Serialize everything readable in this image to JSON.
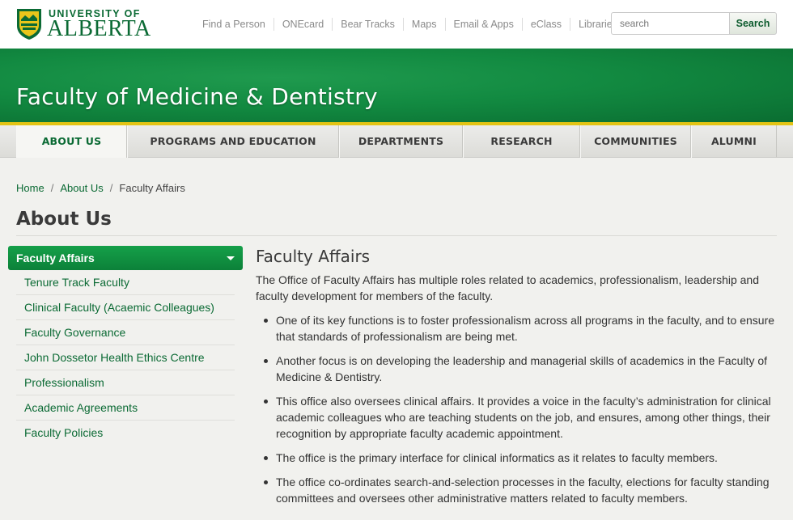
{
  "header": {
    "logo_top": "UNIVERSITY OF",
    "logo_bottom": "ALBERTA",
    "links": [
      "Find a Person",
      "ONEcard",
      "Bear Tracks",
      "Maps",
      "Email & Apps",
      "eClass",
      "Libraries"
    ],
    "search_placeholder": "search",
    "search_button": "Search"
  },
  "banner": {
    "title": "Faculty of Medicine & Dentistry"
  },
  "nav": {
    "items": [
      "ABOUT US",
      "PROGRAMS AND EDUCATION",
      "DEPARTMENTS",
      "RESEARCH",
      "COMMUNITIES",
      "ALUMNI"
    ],
    "active": "ABOUT US"
  },
  "breadcrumb": {
    "home": "Home",
    "sep": "/",
    "about": "About Us",
    "current": "Faculty Affairs"
  },
  "page_title": "About Us",
  "sidebar": {
    "heading": "Faculty Affairs",
    "items": [
      "Tenure Track Faculty",
      "Clinical Faculty (Acaemic Colleagues)",
      "Faculty Governance",
      "John Dossetor Health Ethics Centre",
      "Professionalism",
      "Academic Agreements",
      "Faculty Policies"
    ]
  },
  "main": {
    "heading": "Faculty Affairs",
    "intro": "The Office of Faculty Affairs has multiple roles related to academics, professionalism, leadership and faculty development for members of the faculty.",
    "bullets": [
      "One of its key functions is to foster professionalism across all programs in the faculty, and to ensure that standards of professionalism are being met.",
      "Another focus is on developing the leadership and managerial skills of academics in the Faculty of Medicine & Dentistry.",
      "This office also oversees clinical affairs. It provides a voice in the faculty’s administration for clinical academic colleagues who are teaching students on the job, and ensures, among other things, their recognition by appropriate faculty academic appointment.",
      "The office is the primary interface for clinical informatics as it relates to faculty members.",
      "The office co-ordinates search-and-selection processes in the faculty, elections for faculty standing committees and oversees other administrative matters related to faculty members."
    ]
  },
  "colors": {
    "brand_green": "#0b6a34",
    "banner_green": "#128a41",
    "accent_gold": "#e3c414"
  },
  "icons": [
    "university-crest-icon",
    "dropdown-caret-icon",
    "bullet-icon"
  ]
}
